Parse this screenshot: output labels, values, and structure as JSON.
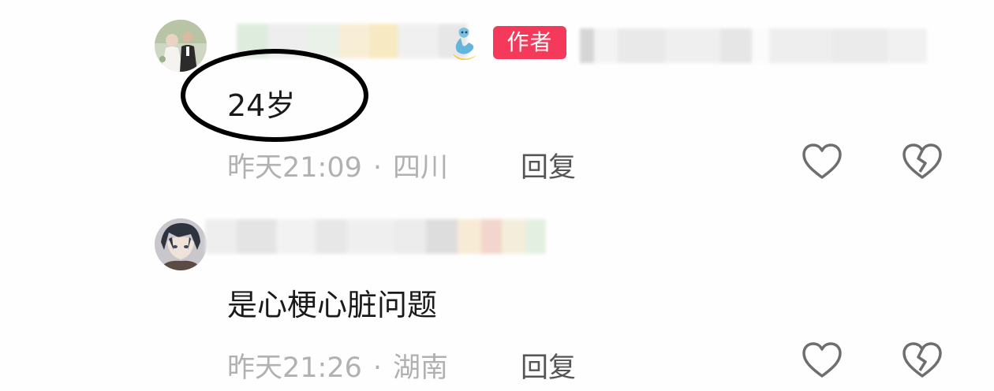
{
  "comments": [
    {
      "author_badge": "作者",
      "text": "24岁",
      "time": "昨天21:09",
      "location": "四川",
      "reply_label": "回复",
      "icons": [
        "avatar-photo",
        "genie-emoji",
        "heart-outline-icon",
        "broken-heart-icon"
      ]
    },
    {
      "text": "是心梗心脏问题",
      "time": "昨天21:26",
      "location": "湖南",
      "reply_label": "回复",
      "icons": [
        "avatar-anime",
        "heart-outline-icon",
        "broken-heart-icon"
      ]
    }
  ],
  "meta_separator": "·",
  "colors": {
    "author_badge_bg": "#f4395a",
    "meta_text": "#b1b1b1",
    "icon_stroke": "#6e6e6e"
  }
}
